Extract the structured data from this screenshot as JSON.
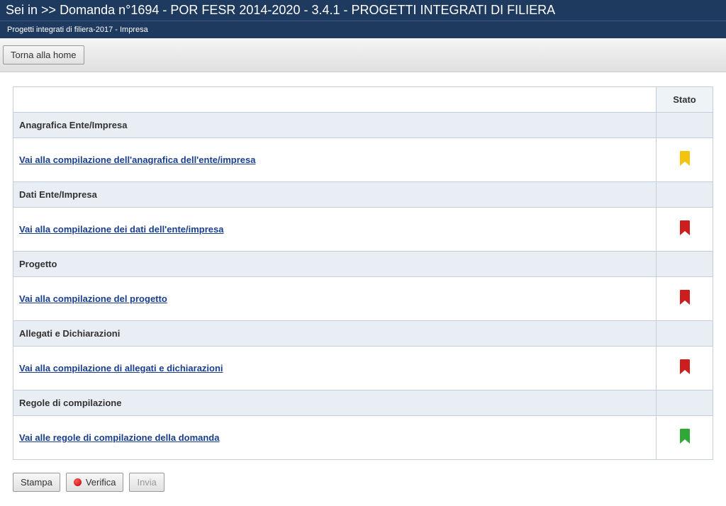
{
  "header": {
    "breadcrumb_prefix": "Sei in >> ",
    "title": "Domanda n°1694 - POR FESR 2014-2020 - 3.4.1 - PROGETTI INTEGRATI DI FILIERA"
  },
  "subheader": {
    "text": "Progetti integrati di filiera-2017 - Impresa"
  },
  "toolbar": {
    "home_label": "Torna alla home"
  },
  "table": {
    "col_empty": "",
    "col_status": "Stato",
    "sections": [
      {
        "title": "Anagrafica Ente/Impresa",
        "link": "Vai alla compilazione dell'anagrafica dell'ente/impresa",
        "status": "yellow"
      },
      {
        "title": "Dati Ente/Impresa",
        "link": "Vai alla compilazione dei dati dell'ente/impresa",
        "status": "red"
      },
      {
        "title": "Progetto",
        "link": "Vai alla compilazione del progetto",
        "status": "red"
      },
      {
        "title": "Allegati e Dichiarazioni",
        "link": "Vai alla compilazione di allegati e dichiarazioni",
        "status": "red"
      },
      {
        "title": "Regole di compilazione",
        "link": "Vai alle regole di compilazione della domanda",
        "status": "green"
      }
    ]
  },
  "footer": {
    "stampa": "Stampa",
    "verifica": "Verifica",
    "invia": "Invia"
  },
  "status_colors": {
    "yellow": "#f2c40f",
    "red": "#cc1e1e",
    "green": "#2fa836"
  }
}
